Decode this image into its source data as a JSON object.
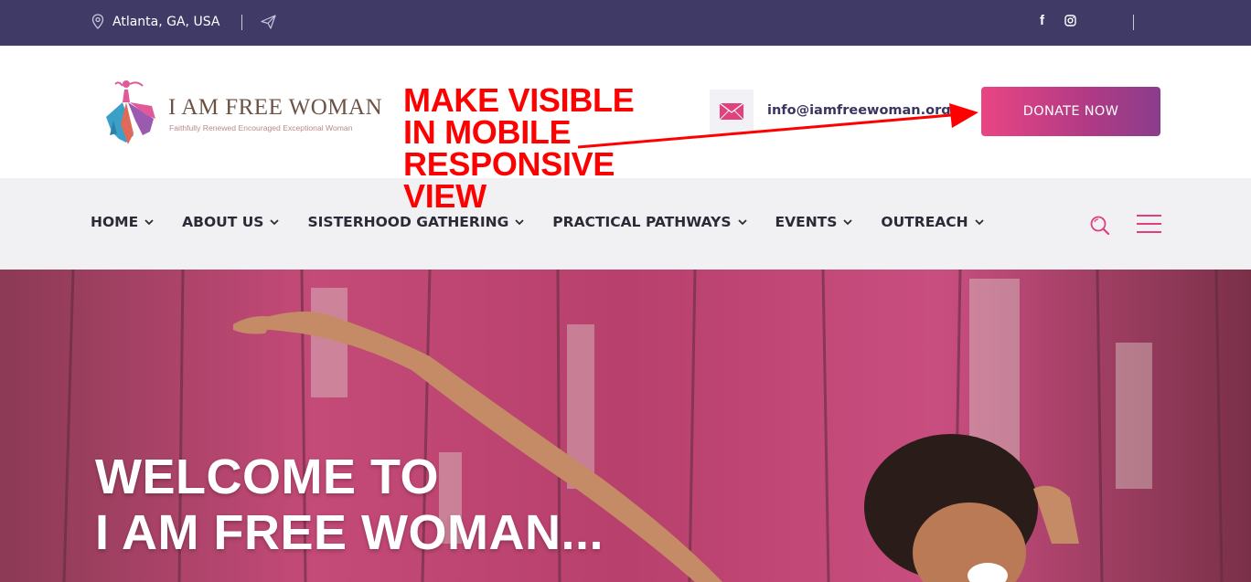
{
  "topbar": {
    "location": "Atlanta, GA, USA",
    "icons": [
      "location-pin-icon",
      "send-icon",
      "facebook-icon",
      "instagram-icon"
    ],
    "facebook_glyph": "f"
  },
  "header": {
    "logo_title": "I AM FREE WOMAN",
    "logo_tagline": "Faithfully Renewed Encouraged Exceptional Woman",
    "email": "info@iamfreewoman.org",
    "donate_label": "DONATE NOW"
  },
  "nav": {
    "items": [
      {
        "label": "HOME"
      },
      {
        "label": "ABOUT US"
      },
      {
        "label": "SISTERHOOD GATHERING"
      },
      {
        "label": "PRACTICAL PATHWAYS"
      },
      {
        "label": "EVENTS"
      },
      {
        "label": "OUTREACH"
      }
    ]
  },
  "hero": {
    "line1": "WELCOME TO",
    "line2": "I AM FREE WOMAN..."
  },
  "annotation": {
    "line1": "MAKE VISIBLE",
    "line2": "IN MOBILE",
    "line3": "RESPONSIVE",
    "line4": "VIEW"
  },
  "colors": {
    "topbar": "#3f3a66",
    "accent": "#e03f7f",
    "nav_bg": "#f1f1f4",
    "annotation": "#ff0000"
  }
}
